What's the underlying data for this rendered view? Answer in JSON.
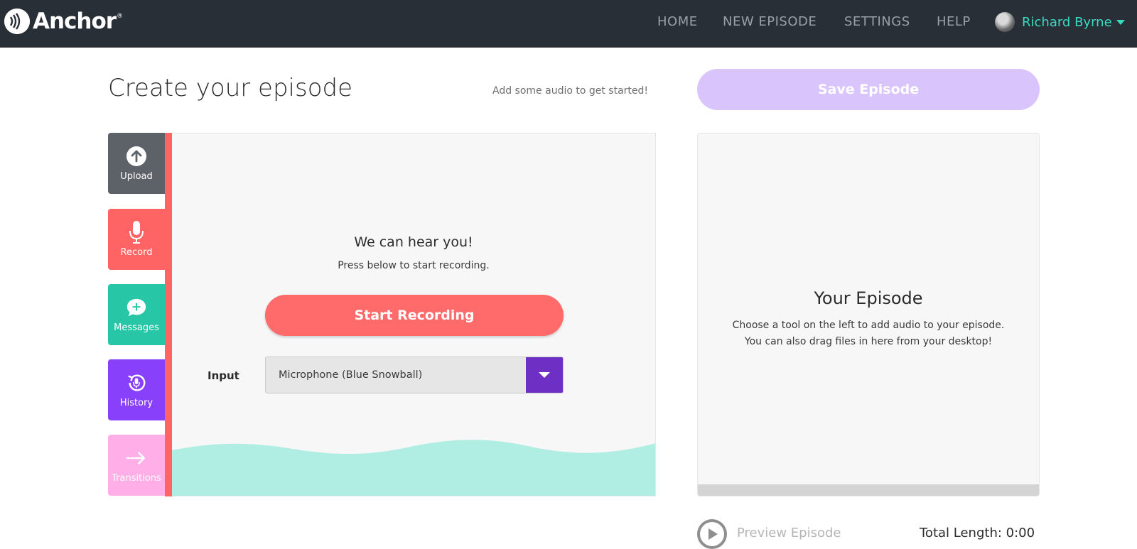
{
  "brand": {
    "name": "Anchor",
    "reg": "®"
  },
  "nav": {
    "home": "HOME",
    "new_episode": "NEW EPISODE",
    "settings": "SETTINGS",
    "help": "HELP",
    "user_name": "Richard Byrne"
  },
  "header": {
    "title": "Create your episode",
    "hint": "Add some audio to get started!",
    "save_label": "Save Episode"
  },
  "tools": [
    {
      "label": "Upload",
      "icon": "upload-icon",
      "color": "#5d6168"
    },
    {
      "label": "Record",
      "icon": "microphone-icon",
      "color": "#ff6464"
    },
    {
      "label": "Messages",
      "icon": "message-plus-icon",
      "color": "#26c6a7"
    },
    {
      "label": "History",
      "icon": "history-icon",
      "color": "#8940fa"
    },
    {
      "label": "Transitions",
      "icon": "arrow-right-icon",
      "color": "#ffaee8"
    }
  ],
  "record": {
    "heading": "We can hear you!",
    "subheading": "Press below to start recording.",
    "start_label": "Start Recording",
    "input_label": "Input",
    "input_value": "Microphone (Blue Snowball)"
  },
  "episode": {
    "title": "Your Episode",
    "desc_line1": "Choose a tool on the left to add audio to your episode.",
    "desc_line2": "You can also drag files in here from your desktop!",
    "preview_label": "Preview Episode",
    "total_length": "Total Length: 0:00"
  },
  "colors": {
    "topbar": "#292f36",
    "accent_teal": "#3ad9c2",
    "record_red": "#ff6464",
    "save_disabled": "#d9c5fb",
    "select_button": "#6d2fc4",
    "wave": "#b0ede2"
  }
}
